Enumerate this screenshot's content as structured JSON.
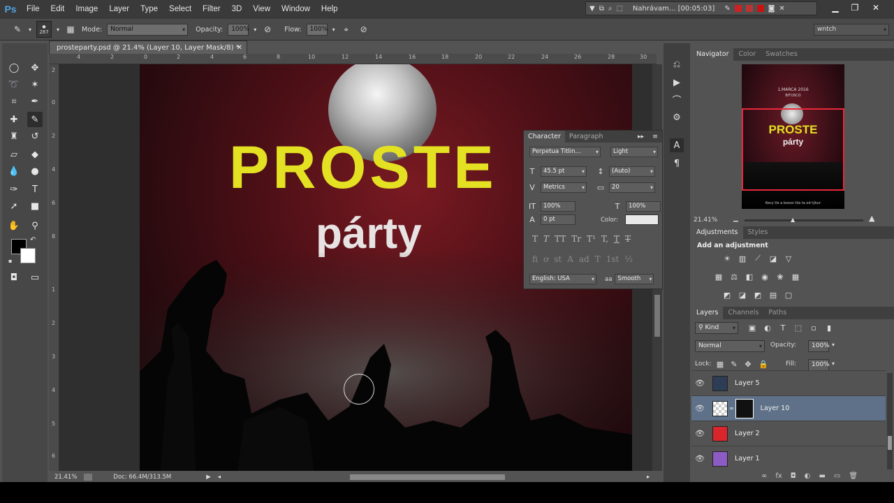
{
  "app": {
    "logo": "Ps"
  },
  "menu": [
    "File",
    "Edit",
    "Image",
    "Layer",
    "Type",
    "Select",
    "Filter",
    "3D",
    "View",
    "Window",
    "Help"
  ],
  "recording": {
    "label": "Nahrávam... [00:05:03]"
  },
  "options": {
    "brush_size": "287",
    "mode_label": "Mode:",
    "mode_value": "Normal",
    "opacity_label": "Opacity:",
    "opacity_value": "100%",
    "flow_label": "Flow:",
    "flow_value": "100%",
    "workspace": "wntch"
  },
  "document": {
    "tab_title": "prosteparty.psd @ 21.4% (Layer 10, Layer Mask/8) *",
    "ruler_h": [
      "4",
      "2",
      "0",
      "2",
      "4",
      "6",
      "8",
      "10",
      "12",
      "14",
      "16",
      "18",
      "20",
      "22",
      "24",
      "26",
      "28",
      "30"
    ],
    "ruler_v": [
      "2",
      "0",
      "2",
      "4",
      "6",
      "8",
      "1",
      "2",
      "3",
      "4",
      "5",
      "6"
    ],
    "zoom": "21.41%",
    "doc_size": "Doc: 66.4M/313.5M"
  },
  "artwork": {
    "title": "PROSTE",
    "subtitle": "párty"
  },
  "character": {
    "tabs": [
      "Character",
      "Paragraph"
    ],
    "font_family": "Perpetua Titlin...",
    "font_style": "Light",
    "size": "45.5 pt",
    "leading": "(Auto)",
    "kerning": "Metrics",
    "tracking": "20",
    "vscale": "100%",
    "hscale": "100%",
    "baseline": "0 pt",
    "color_label": "Color:",
    "color_value": "#e8e8e8",
    "glyphs1": [
      "T",
      "T",
      "TT",
      "Tr",
      "T¹",
      "T,",
      "T",
      "T"
    ],
    "glyphs2": [
      "fi",
      "ơ",
      "st",
      "A",
      "ad",
      "T",
      "1st",
      "½"
    ],
    "language": "English: USA",
    "aa_label": "aa",
    "antialias": "Smooth"
  },
  "navigator": {
    "tabs": [
      "Navigator",
      "Color",
      "Swatches"
    ],
    "zoom": "21.41%",
    "thumb_title": "PROSTE",
    "thumb_sub": "párty",
    "thumb_date": "1.MARCA 2016",
    "thumb_date2": "BITUSCO",
    "thumb_footer": "Kecy tle a boxov tila ta od týkur"
  },
  "adjustments": {
    "tabs": [
      "Adjustments",
      "Styles"
    ],
    "title": "Add an adjustment"
  },
  "layers": {
    "tabs": [
      "Layers",
      "Channels",
      "Paths"
    ],
    "filter": "Kind",
    "blend": "Normal",
    "opacity_label": "Opacity:",
    "opacity": "100%",
    "lock_label": "Lock:",
    "fill_label": "Fill:",
    "fill": "100%",
    "items": [
      {
        "name": "Layer 5",
        "color": "#2c3d55"
      },
      {
        "name": "Layer 10",
        "color": "#111"
      },
      {
        "name": "Layer 2",
        "color": "#d8262c"
      },
      {
        "name": "Layer 1",
        "color": "#8c5cc4"
      }
    ]
  }
}
